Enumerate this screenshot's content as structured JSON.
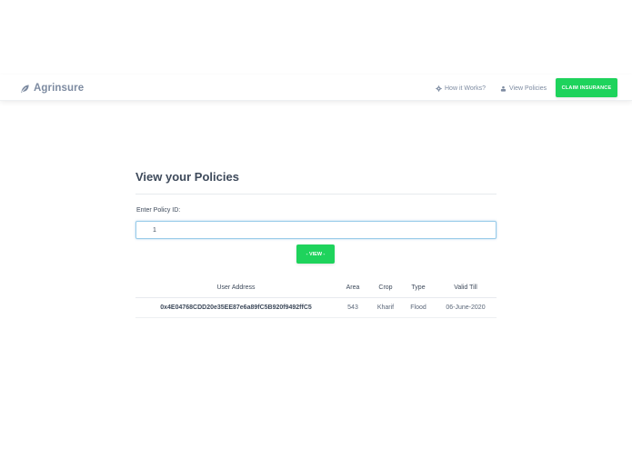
{
  "navbar": {
    "brand": "Agrinsure",
    "brand_icon": "leaf-icon",
    "links": [
      {
        "label": "How it Works?",
        "icon": "gear-icon"
      },
      {
        "label": "View Policies",
        "icon": "users-icon"
      }
    ],
    "cta_label": "CLAIM INSURANCE"
  },
  "main": {
    "title": "View your Policies",
    "input_label": "Enter Policy ID:",
    "input_value": "1",
    "view_button": "- VIEW -"
  },
  "table": {
    "headers": [
      "User Address",
      "Area",
      "Crop",
      "Type",
      "Valid Till"
    ],
    "rows": [
      {
        "address": "0x4E04768CDD20e35EE87e6a89fC5B920f9492ffC5",
        "area": "543",
        "crop": "Kharif",
        "type": "Flood",
        "valid_till": "06-June-2020"
      }
    ]
  },
  "colors": {
    "accent_green": "#1ed35c",
    "text_dark": "#3e4a5b",
    "text_muted": "#7d8ba1",
    "input_focus": "#98cbe9"
  }
}
